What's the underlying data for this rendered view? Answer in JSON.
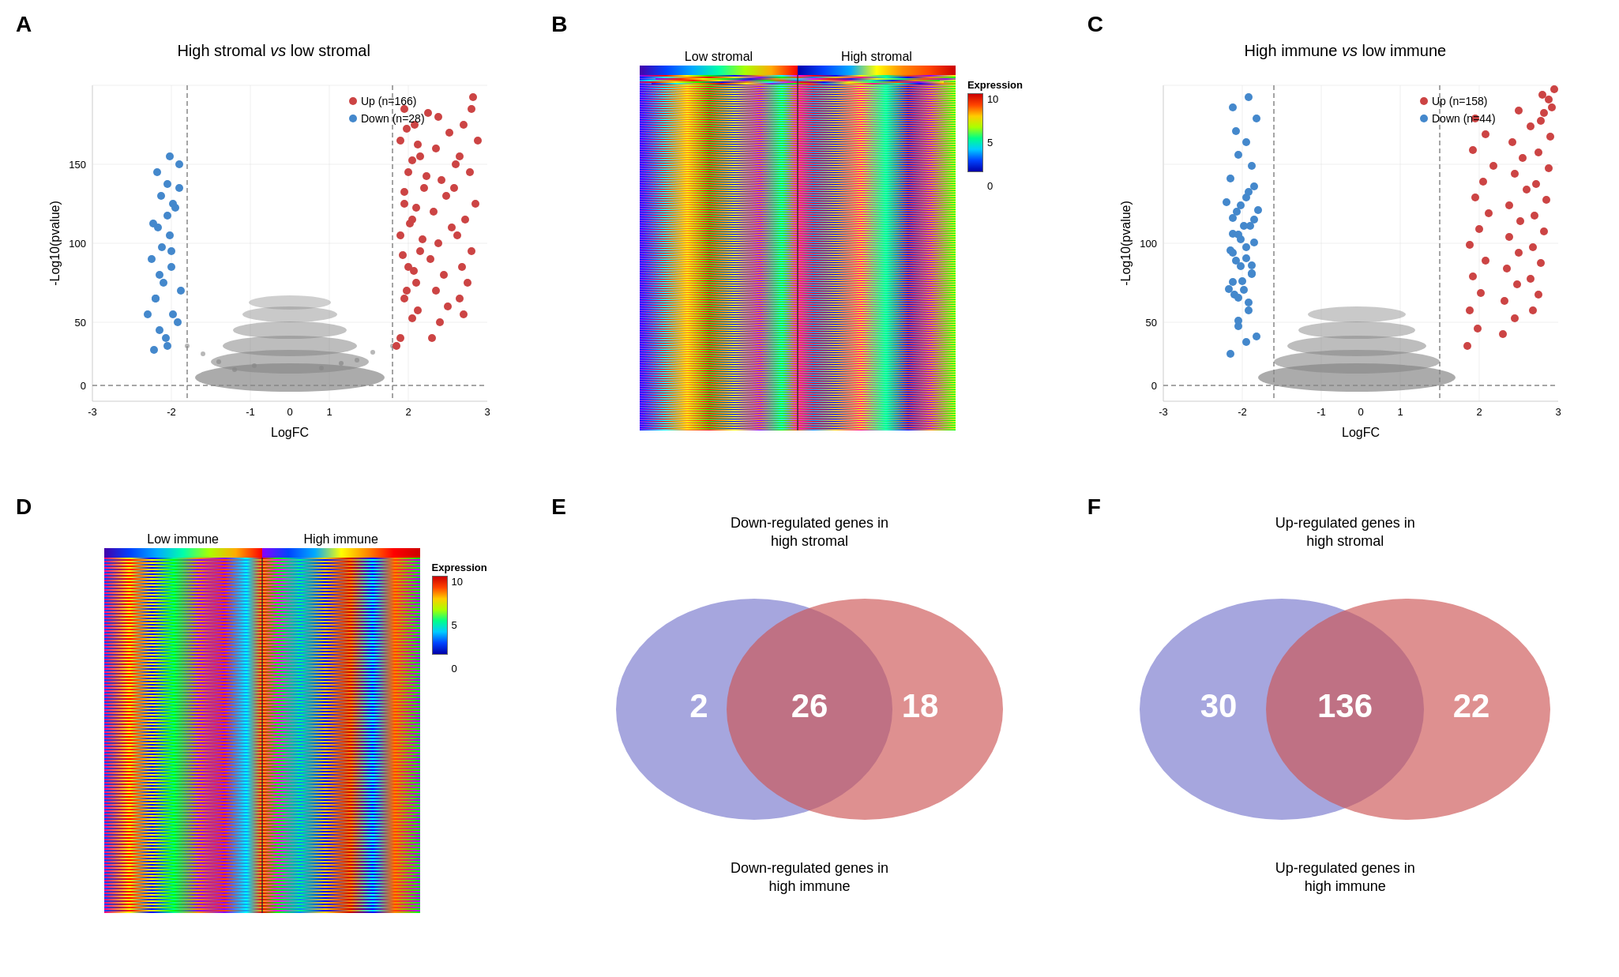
{
  "panels": {
    "A": {
      "label": "A",
      "title": "High stromal vs low stromal",
      "xaxis": "LogFC",
      "yaxis": "-Log10(pvalue)",
      "legend": {
        "up_label": "Up (n=166)",
        "down_label": "Down (n=28)"
      }
    },
    "B": {
      "label": "B",
      "col1": "Low stromal",
      "col2": "High stromal",
      "expression_label": "Expression",
      "scale_min": "0",
      "scale_mid": "5",
      "scale_max": "10"
    },
    "C": {
      "label": "C",
      "title": "High immune vs low immune",
      "xaxis": "LogFC",
      "yaxis": "-Log10(pvalue)",
      "legend": {
        "up_label": "Up (n=158)",
        "down_label": "Down (n=44)"
      }
    },
    "D": {
      "label": "D",
      "col1": "Low immune",
      "col2": "High immune",
      "expression_label": "Expression",
      "scale_min": "0",
      "scale_mid": "5",
      "scale_max": "10"
    },
    "E": {
      "label": "E",
      "top_label": "Down-regulated genes in\nhigh stromal",
      "bottom_label": "Down-regulated genes in\nhigh immune",
      "left_num": "2",
      "overlap_num": "26",
      "right_num": "18"
    },
    "F": {
      "label": "F",
      "top_label": "Up-regulated genes in\nhigh stromal",
      "bottom_label": "Up-regulated genes in\nhigh immune",
      "left_num": "30",
      "overlap_num": "136",
      "right_num": "22"
    }
  }
}
